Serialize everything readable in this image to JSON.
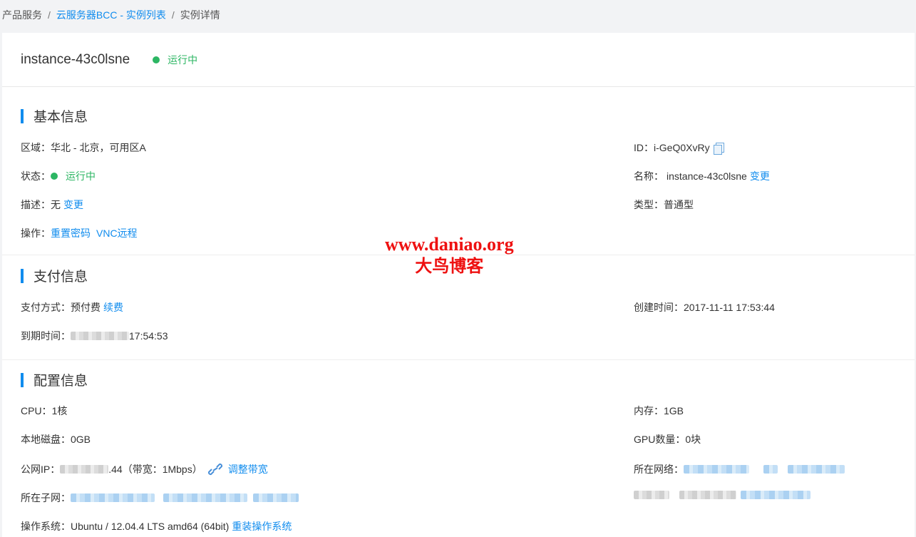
{
  "breadcrumb": {
    "item1": "产品服务",
    "sep": "/",
    "item2": "云服务器BCC - 实例列表",
    "item3": "实例详情"
  },
  "header": {
    "instance_name": "instance-43c0lsne",
    "status": "运行中",
    "status_color": "#2cb663"
  },
  "basic": {
    "title": "基本信息",
    "region_label": "区域：",
    "region_value": "华北 - 北京，可用区A",
    "id_label": "ID：",
    "id_value": "i-GeQ0XvRy",
    "state_label": "状态：",
    "state_value": "运行中",
    "name_label": "名称：",
    "name_value": "instance-43c0lsne",
    "name_change": "变更",
    "desc_label": "描述：",
    "desc_value": "无",
    "desc_change": "变更",
    "type_label": "类型：",
    "type_value": "普通型",
    "ops_label": "操作：",
    "ops_reset_pwd": "重置密码",
    "ops_vnc": "VNC远程"
  },
  "payment": {
    "title": "支付信息",
    "method_label": "支付方式：",
    "method_value": "预付费",
    "renew": "续费",
    "created_label": "创建时间：",
    "created_value": "2017-11-11 17:53:44",
    "expire_label": "到期时间：",
    "expire_value_tail": "17:54:53"
  },
  "config": {
    "title": "配置信息",
    "cpu_label": "CPU：",
    "cpu_value": "1核",
    "mem_label": "内存：",
    "mem_value": "1GB",
    "disk_label": "本地磁盘：",
    "disk_value": "0GB",
    "gpu_label": "GPU数量：",
    "gpu_value": "0块",
    "ip_label": "公网IP：",
    "ip_tail": ".44",
    "bandwidth": "（带宽：1Mbps）",
    "adjust_bandwidth": "调整带宽",
    "network_label": "所在网络：",
    "subnet_label": "所在子网：",
    "os_label": "操作系统：",
    "os_value": "Ubuntu / 12.04.4 LTS amd64 (64bit)",
    "reinstall_os": "重装操作系统"
  },
  "watermark": {
    "line1": "www.daniao.org",
    "line2": "大鸟博客"
  },
  "colors": {
    "accent": "#108cee",
    "success": "#2cb663",
    "watermark": "#e11111"
  },
  "icons": {
    "copy": "copy-icon",
    "link": "link-icon"
  }
}
